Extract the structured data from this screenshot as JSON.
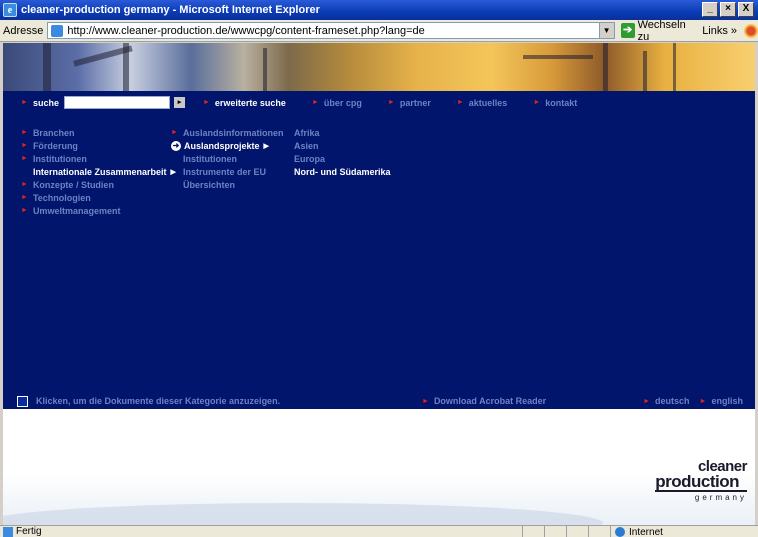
{
  "window": {
    "title": "cleaner-production germany - Microsoft Internet Explorer",
    "btn_minimize": "_",
    "btn_maximize": "×",
    "btn_close": "X"
  },
  "addressbar": {
    "label": "Adresse",
    "url": "http://www.cleaner-production.de/wwwcpg/content-frameset.php?lang=de",
    "go_label": "Wechseln zu",
    "links_label": "Links",
    "links_more": "»"
  },
  "topnav": {
    "search_label": "suche",
    "search_value": "",
    "search_go": "▸",
    "items": [
      {
        "label": "erweiterte suche",
        "active": true
      },
      {
        "label": "über cpg",
        "active": false
      },
      {
        "label": "partner",
        "active": false
      },
      {
        "label": "aktuelles",
        "active": false
      },
      {
        "label": "kontakt",
        "active": false
      }
    ]
  },
  "menu": {
    "column1": [
      {
        "label": "Branchen"
      },
      {
        "label": "Förderung"
      },
      {
        "label": "Institutionen"
      },
      {
        "label": "Internationale Zusammenarbeit"
      },
      {
        "label": "Konzepte / Studien"
      },
      {
        "label": "Technologien"
      },
      {
        "label": "Umweltmanagement"
      }
    ],
    "column2": [
      {
        "label": "Auslandsinformationen"
      },
      {
        "label": "Auslandsprojekte"
      },
      {
        "label": "Institutionen"
      },
      {
        "label": "Instrumente der EU"
      },
      {
        "label": "Übersichten"
      }
    ],
    "column3": [
      {
        "label": "Afrika"
      },
      {
        "label": "Asien"
      },
      {
        "label": "Europa"
      },
      {
        "label": "Nord- und Südamerika"
      }
    ],
    "arrow": "▶"
  },
  "infobar": {
    "hint": "Klicken, um die Dokumente dieser Kategorie anzuzeigen.",
    "acrobat": "Download Acrobat Reader",
    "lang_de": "deutsch",
    "lang_en": "english"
  },
  "logo": {
    "line1": "cleaner",
    "line2": "production",
    "line3": "germany"
  },
  "statusbar": {
    "status": "Fertig",
    "zone": "Internet"
  },
  "colors": {
    "content_bg": "#00156b",
    "menu_text": "#6e82c4",
    "bullet": "#e2231a",
    "active_text": "#ffffff"
  }
}
